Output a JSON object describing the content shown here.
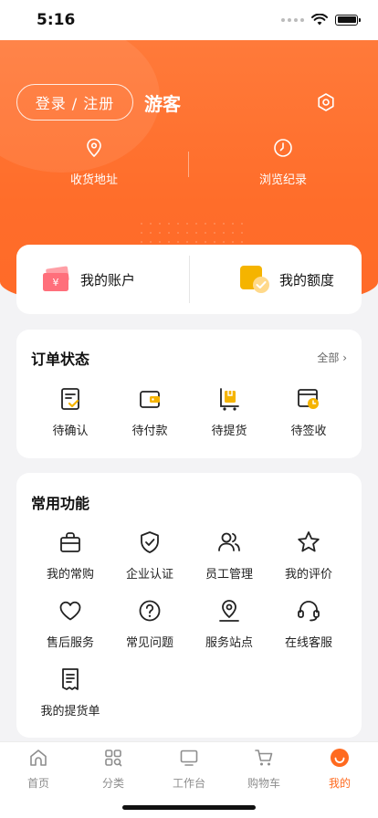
{
  "status_bar": {
    "time": "5:16"
  },
  "header": {
    "login_label": "登录 / 注册",
    "user_name": "游客",
    "links": [
      {
        "label": "收货地址",
        "icon": "location-pin-icon"
      },
      {
        "label": "浏览纪录",
        "icon": "clock-icon"
      }
    ]
  },
  "account": {
    "items": [
      {
        "label": "我的账户",
        "icon": "wallet-card-icon"
      },
      {
        "label": "我的额度",
        "icon": "credit-quota-icon"
      }
    ]
  },
  "orders": {
    "title": "订单状态",
    "all_label": "全部",
    "items": [
      {
        "label": "待确认",
        "icon": "confirm-doc-icon"
      },
      {
        "label": "待付款",
        "icon": "wallet-icon"
      },
      {
        "label": "待提货",
        "icon": "pickup-cart-icon"
      },
      {
        "label": "待签收",
        "icon": "sign-clock-icon"
      }
    ]
  },
  "functions": {
    "title": "常用功能",
    "items": [
      {
        "label": "我的常购",
        "icon": "shopping-bag-icon"
      },
      {
        "label": "企业认证",
        "icon": "shield-check-icon"
      },
      {
        "label": "员工管理",
        "icon": "users-icon"
      },
      {
        "label": "我的评价",
        "icon": "star-icon"
      },
      {
        "label": "售后服务",
        "icon": "heart-icon"
      },
      {
        "label": "常见问题",
        "icon": "question-icon"
      },
      {
        "label": "服务站点",
        "icon": "map-pin-icon"
      },
      {
        "label": "在线客服",
        "icon": "headset-icon"
      },
      {
        "label": "我的提货单",
        "icon": "receipt-icon"
      }
    ]
  },
  "tab_bar": {
    "items": [
      {
        "label": "首页",
        "icon": "home-icon"
      },
      {
        "label": "分类",
        "icon": "category-icon"
      },
      {
        "label": "工作台",
        "icon": "monitor-icon"
      },
      {
        "label": "购物车",
        "icon": "cart-icon"
      },
      {
        "label": "我的",
        "icon": "profile-smile-icon",
        "active": true
      }
    ]
  },
  "colors": {
    "accent": "#ff6a1f",
    "hero": "#ff7a3a",
    "icon_highlight": "#f5b400"
  }
}
